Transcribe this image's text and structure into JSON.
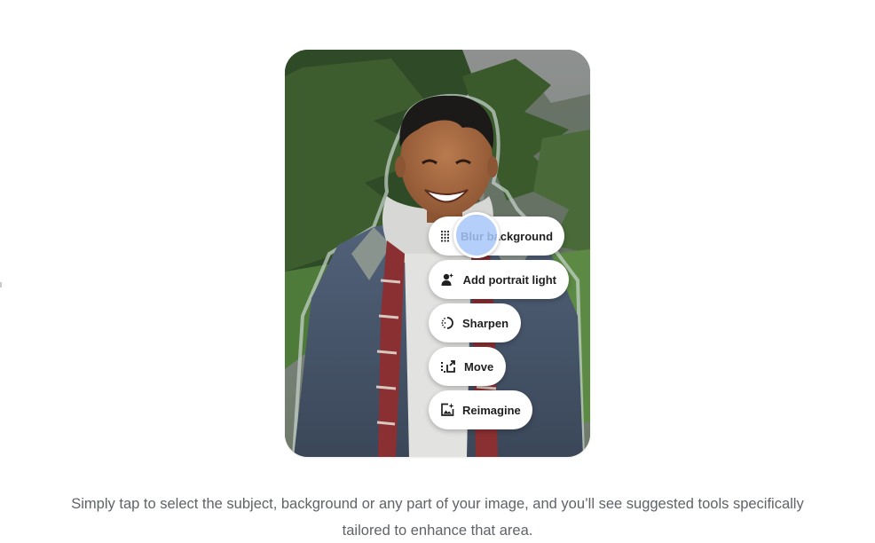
{
  "tools": {
    "blur_background": {
      "label": "Blur background",
      "icon": "dots-grid-icon"
    },
    "add_portrait_light": {
      "label": "Add portrait light",
      "icon": "person-light-icon"
    },
    "sharpen": {
      "label": "Sharpen",
      "icon": "sharpen-icon"
    },
    "move": {
      "label": "Move",
      "icon": "move-icon"
    },
    "reimagine": {
      "label": "Reimagine",
      "icon": "reimagine-icon"
    }
  },
  "caption": {
    "line1": "Simply tap to select the subject, background or any part of your image, and you’ll see suggested tools specifically",
    "line2": "tailored to enhance that area."
  },
  "colors": {
    "chip_text": "#1f1f1f",
    "caption_text": "#5f6368",
    "tap_highlight": "#a8c7fa"
  }
}
